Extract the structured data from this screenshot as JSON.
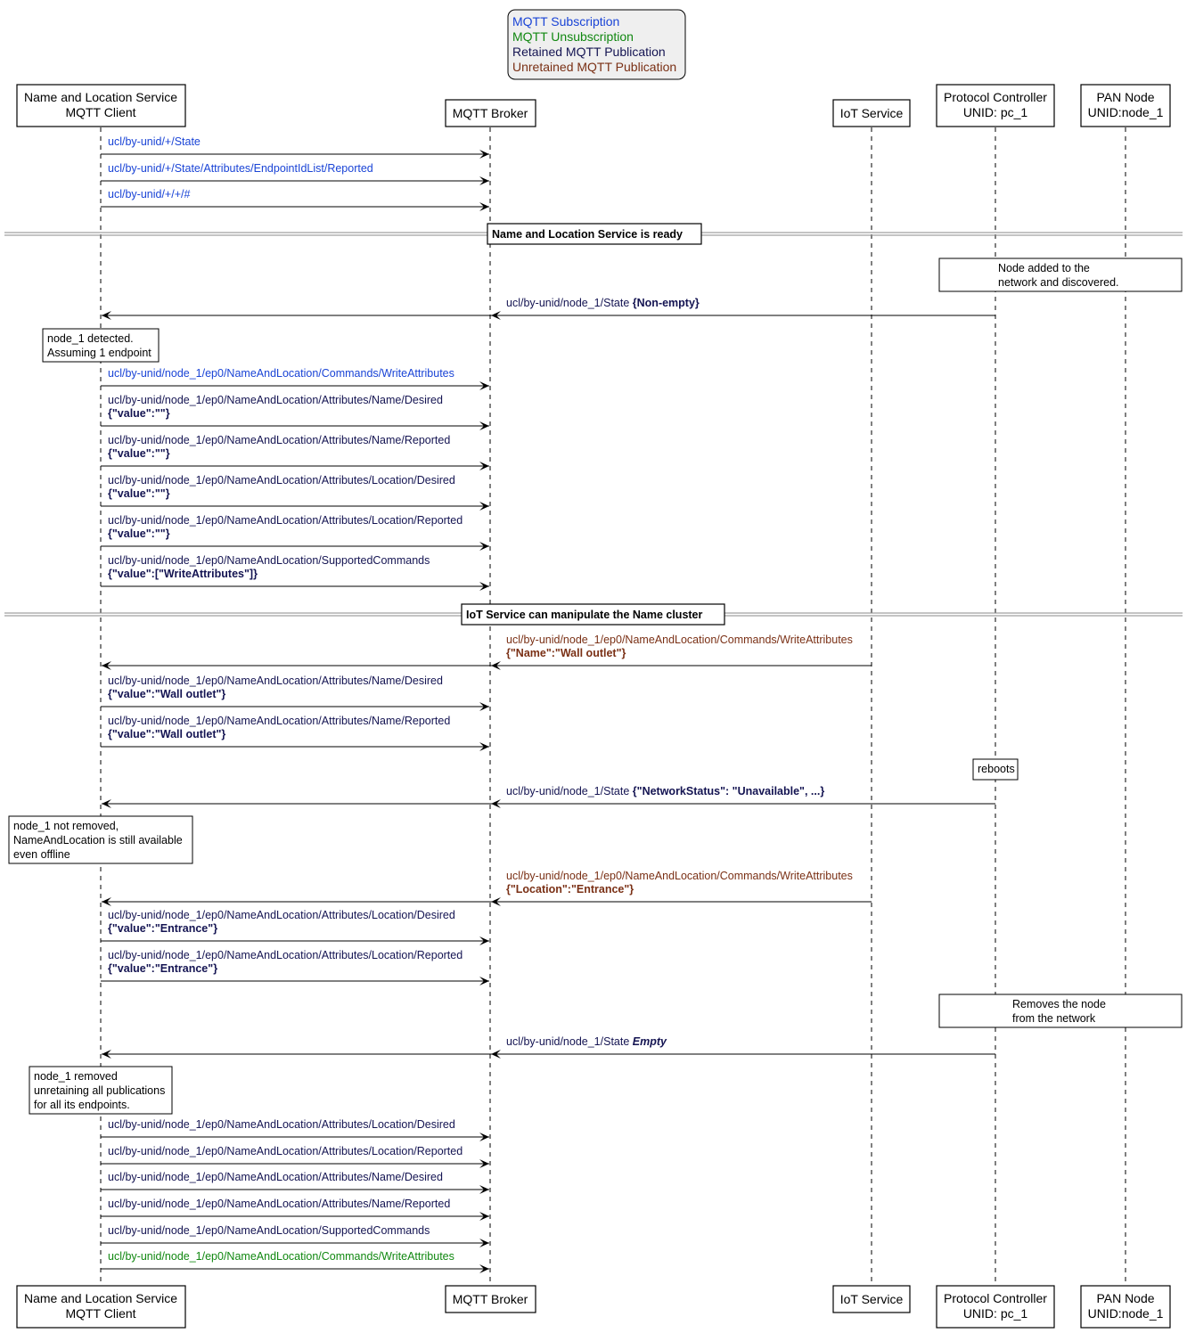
{
  "legend": {
    "items": [
      {
        "label": "MQTT Subscription",
        "kind": "sub"
      },
      {
        "label": "MQTT Unsubscription",
        "kind": "unsub"
      },
      {
        "label": "Retained MQTT Publication",
        "kind": "ret"
      },
      {
        "label": "Unretained MQTT Publication",
        "kind": "unret"
      }
    ]
  },
  "colors": {
    "sub": "#1a44d6",
    "unsub": "#118811",
    "ret": "#141452",
    "unret": "#7a3015"
  },
  "participants": [
    {
      "id": "nls",
      "lines": [
        "Name and Location Service",
        "MQTT Client"
      ]
    },
    {
      "id": "broker",
      "lines": [
        "MQTT Broker"
      ]
    },
    {
      "id": "iot",
      "lines": [
        "IoT Service"
      ]
    },
    {
      "id": "pc",
      "lines": [
        "Protocol Controller",
        "UNID: pc_1"
      ]
    },
    {
      "id": "pan",
      "lines": [
        "PAN Node",
        "UNID:node_1"
      ]
    }
  ],
  "events": [
    {
      "type": "msg",
      "from": "nls",
      "to": "broker",
      "kind": "sub",
      "lines": [
        [
          {
            "t": "ucl/by-unid/+/State"
          }
        ]
      ]
    },
    {
      "type": "msg",
      "from": "nls",
      "to": "broker",
      "kind": "sub",
      "lines": [
        [
          {
            "t": "ucl/by-unid/+/State/Attributes/EndpointIdList/Reported"
          }
        ]
      ]
    },
    {
      "type": "msg",
      "from": "nls",
      "to": "broker",
      "kind": "sub",
      "lines": [
        [
          {
            "t": "ucl/by-unid/+/+/#"
          }
        ]
      ]
    },
    {
      "type": "divider",
      "label": "Name and Location Service is ready"
    },
    {
      "type": "note",
      "over": [
        "pc",
        "pan"
      ],
      "lines": [
        "Node added to the",
        "network and discovered."
      ]
    },
    {
      "type": "msg",
      "from": "pc",
      "to": "broker",
      "to2": "nls",
      "kind": "ret",
      "lines": [
        [
          {
            "t": "ucl/by-unid/node_1/State "
          },
          {
            "t": "{Non-empty}",
            "b": true
          }
        ]
      ]
    },
    {
      "type": "note",
      "over": [
        "nls"
      ],
      "lines": [
        "node_1 detected.",
        "Assuming 1 endpoint"
      ]
    },
    {
      "type": "msg",
      "from": "nls",
      "to": "broker",
      "kind": "sub",
      "lines": [
        [
          {
            "t": "ucl/by-unid/node_1/ep0/NameAndLocation/Commands/WriteAttributes"
          }
        ]
      ]
    },
    {
      "type": "msg",
      "from": "nls",
      "to": "broker",
      "kind": "ret",
      "lines": [
        [
          {
            "t": "ucl/by-unid/node_1/ep0/NameAndLocation/Attributes/Name/Desired"
          }
        ],
        [
          {
            "t": "{\"value\":\"\"}",
            "b": true
          }
        ]
      ]
    },
    {
      "type": "msg",
      "from": "nls",
      "to": "broker",
      "kind": "ret",
      "lines": [
        [
          {
            "t": "ucl/by-unid/node_1/ep0/NameAndLocation/Attributes/Name/Reported"
          }
        ],
        [
          {
            "t": "{\"value\":\"\"}",
            "b": true
          }
        ]
      ]
    },
    {
      "type": "msg",
      "from": "nls",
      "to": "broker",
      "kind": "ret",
      "lines": [
        [
          {
            "t": "ucl/by-unid/node_1/ep0/NameAndLocation/Attributes/Location/Desired"
          }
        ],
        [
          {
            "t": "{\"value\":\"\"}",
            "b": true
          }
        ]
      ]
    },
    {
      "type": "msg",
      "from": "nls",
      "to": "broker",
      "kind": "ret",
      "lines": [
        [
          {
            "t": "ucl/by-unid/node_1/ep0/NameAndLocation/Attributes/Location/Reported"
          }
        ],
        [
          {
            "t": "{\"value\":\"\"}",
            "b": true
          }
        ]
      ]
    },
    {
      "type": "msg",
      "from": "nls",
      "to": "broker",
      "kind": "ret",
      "lines": [
        [
          {
            "t": "ucl/by-unid/node_1/ep0/NameAndLocation/SupportedCommands"
          }
        ],
        [
          {
            "t": "{\"value\":[\"WriteAttributes\"]}",
            "b": true
          }
        ]
      ]
    },
    {
      "type": "divider",
      "label": "IoT Service can manipulate the Name cluster"
    },
    {
      "type": "msg",
      "from": "iot",
      "to": "broker",
      "to2": "nls",
      "kind": "unret",
      "lines": [
        [
          {
            "t": "ucl/by-unid/node_1/ep0/NameAndLocation/Commands/WriteAttributes"
          }
        ],
        [
          {
            "t": "{\"Name\":\"Wall outlet\"}",
            "b": true
          }
        ]
      ]
    },
    {
      "type": "msg",
      "from": "nls",
      "to": "broker",
      "kind": "ret",
      "lines": [
        [
          {
            "t": "ucl/by-unid/node_1/ep0/NameAndLocation/Attributes/Name/Desired"
          }
        ],
        [
          {
            "t": "{\"value\":\"Wall outlet\"}",
            "b": true
          }
        ]
      ]
    },
    {
      "type": "msg",
      "from": "nls",
      "to": "broker",
      "kind": "ret",
      "lines": [
        [
          {
            "t": "ucl/by-unid/node_1/ep0/NameAndLocation/Attributes/Name/Reported"
          }
        ],
        [
          {
            "t": "{\"value\":\"Wall outlet\"}",
            "b": true
          }
        ]
      ]
    },
    {
      "type": "note",
      "over": [
        "pc"
      ],
      "lines": [
        "reboots"
      ]
    },
    {
      "type": "msg",
      "from": "pc",
      "to": "broker",
      "to2": "nls",
      "kind": "ret",
      "lines": [
        [
          {
            "t": "ucl/by-unid/node_1/State "
          },
          {
            "t": "{\"NetworkStatus\": \"Unavailable\", ...}",
            "b": true
          }
        ]
      ]
    },
    {
      "type": "note",
      "over": [
        "nls"
      ],
      "lines": [
        "node_1 not removed,",
        "NameAndLocation is still available",
        "even offline"
      ]
    },
    {
      "type": "msg",
      "from": "iot",
      "to": "broker",
      "to2": "nls",
      "kind": "unret",
      "lines": [
        [
          {
            "t": "ucl/by-unid/node_1/ep0/NameAndLocation/Commands/WriteAttributes"
          }
        ],
        [
          {
            "t": "{\"Location\":\"Entrance\"}",
            "b": true
          }
        ]
      ]
    },
    {
      "type": "msg",
      "from": "nls",
      "to": "broker",
      "kind": "ret",
      "lines": [
        [
          {
            "t": "ucl/by-unid/node_1/ep0/NameAndLocation/Attributes/Location/Desired"
          }
        ],
        [
          {
            "t": "{\"value\":\"Entrance\"}",
            "b": true
          }
        ]
      ]
    },
    {
      "type": "msg",
      "from": "nls",
      "to": "broker",
      "kind": "ret",
      "lines": [
        [
          {
            "t": "ucl/by-unid/node_1/ep0/NameAndLocation/Attributes/Location/Reported"
          }
        ],
        [
          {
            "t": "{\"value\":\"Entrance\"}",
            "b": true
          }
        ]
      ]
    },
    {
      "type": "note",
      "over": [
        "pc",
        "pan"
      ],
      "lines": [
        "Removes the node",
        "from the network"
      ]
    },
    {
      "type": "msg",
      "from": "pc",
      "to": "broker",
      "to2": "nls",
      "kind": "ret",
      "lines": [
        [
          {
            "t": "ucl/by-unid/node_1/State "
          },
          {
            "t": "Empty",
            "b": true,
            "i": true
          }
        ]
      ]
    },
    {
      "type": "note",
      "over": [
        "nls"
      ],
      "lines": [
        "node_1 removed",
        "unretaining all publications",
        "for all its endpoints."
      ]
    },
    {
      "type": "msg",
      "from": "nls",
      "to": "broker",
      "kind": "ret",
      "lines": [
        [
          {
            "t": "ucl/by-unid/node_1/ep0/NameAndLocation/Attributes/Location/Desired"
          }
        ]
      ]
    },
    {
      "type": "msg",
      "from": "nls",
      "to": "broker",
      "kind": "ret",
      "lines": [
        [
          {
            "t": "ucl/by-unid/node_1/ep0/NameAndLocation/Attributes/Location/Reported"
          }
        ]
      ]
    },
    {
      "type": "msg",
      "from": "nls",
      "to": "broker",
      "kind": "ret",
      "lines": [
        [
          {
            "t": "ucl/by-unid/node_1/ep0/NameAndLocation/Attributes/Name/Desired"
          }
        ]
      ]
    },
    {
      "type": "msg",
      "from": "nls",
      "to": "broker",
      "kind": "ret",
      "lines": [
        [
          {
            "t": "ucl/by-unid/node_1/ep0/NameAndLocation/Attributes/Name/Reported"
          }
        ]
      ]
    },
    {
      "type": "msg",
      "from": "nls",
      "to": "broker",
      "kind": "ret",
      "lines": [
        [
          {
            "t": "ucl/by-unid/node_1/ep0/NameAndLocation/SupportedCommands"
          }
        ]
      ]
    },
    {
      "type": "msg",
      "from": "nls",
      "to": "broker",
      "kind": "unsub",
      "lines": [
        [
          {
            "t": "ucl/by-unid/node_1/ep0/NameAndLocation/Commands/WriteAttributes"
          }
        ]
      ]
    }
  ]
}
